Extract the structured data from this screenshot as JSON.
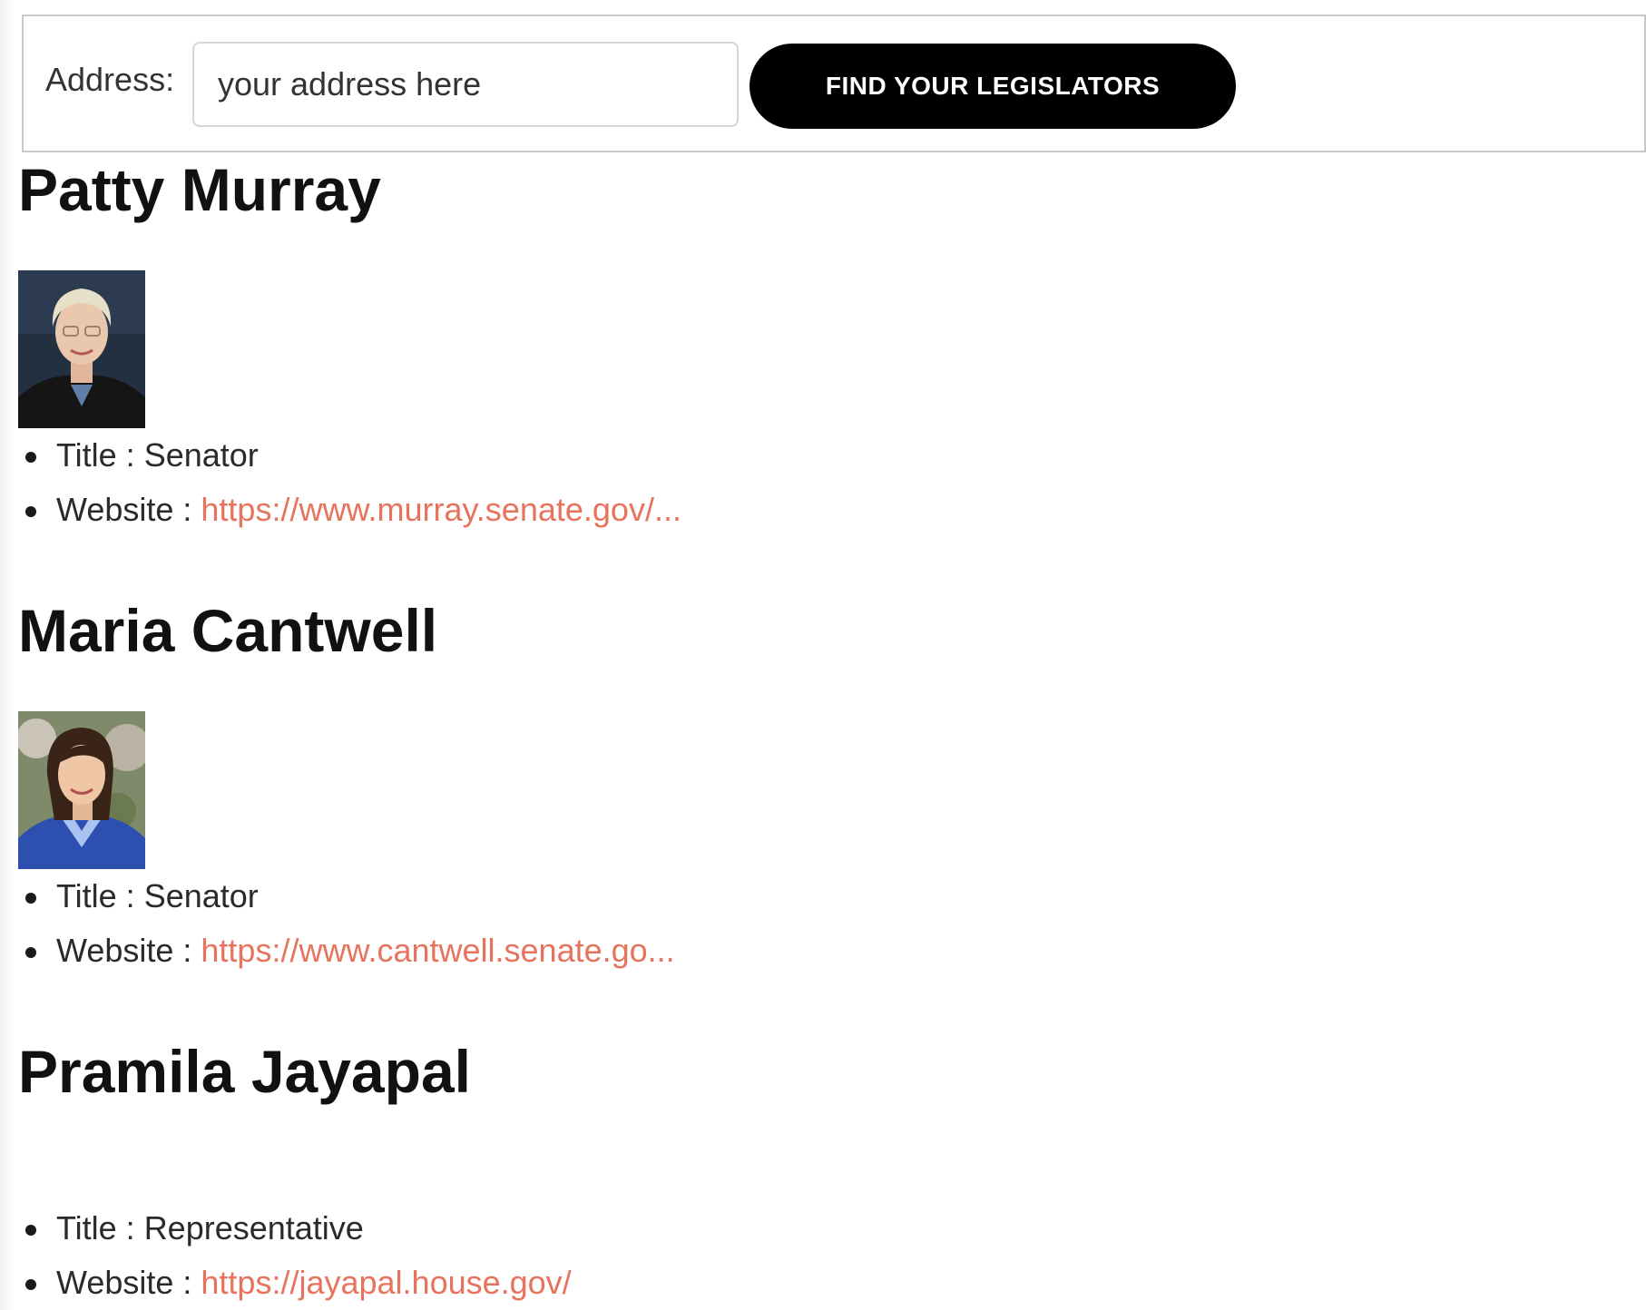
{
  "search": {
    "address_label": "Address:",
    "address_placeholder": "your address here",
    "address_value": "",
    "button_label": "FIND YOUR LEGISLATORS"
  },
  "legislators": [
    {
      "name": "Patty Murray",
      "has_photo": true,
      "title_label": "Title : ",
      "title": "Senator",
      "website_label": "Website : ",
      "website_text": "https://www.murray.senate.gov/...",
      "website_href": "https://www.murray.senate.gov/"
    },
    {
      "name": "Maria Cantwell",
      "has_photo": true,
      "title_label": "Title : ",
      "title": "Senator",
      "website_label": "Website : ",
      "website_text": "https://www.cantwell.senate.go...",
      "website_href": "https://www.cantwell.senate.gov/"
    },
    {
      "name": "Pramila Jayapal",
      "has_photo": false,
      "title_label": "Title : ",
      "title": "Representative",
      "website_label": "Website : ",
      "website_text": "https://jayapal.house.gov/",
      "website_href": "https://jayapal.house.gov/"
    }
  ],
  "colors": {
    "link": "#e8735c",
    "button_bg": "#000000",
    "button_text": "#ffffff"
  }
}
